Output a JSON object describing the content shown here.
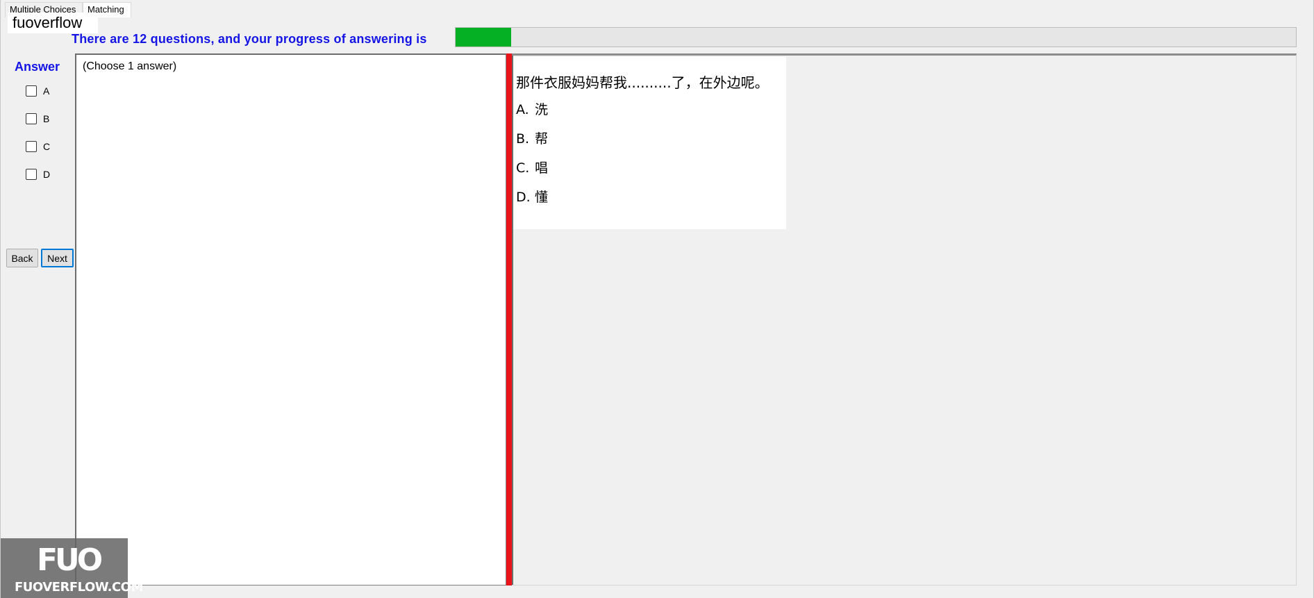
{
  "tabs": [
    {
      "label": "Multiple Choices"
    },
    {
      "label": "Matching"
    }
  ],
  "watermark_label": "fuoverflow",
  "progress": {
    "text": "There are 12 questions, and your progress of answering is",
    "fraction": 0.066
  },
  "answer_panel": {
    "title": "Answer",
    "options": [
      "A",
      "B",
      "C",
      "D"
    ],
    "back_label": "Back",
    "next_label": "Next"
  },
  "question_area": {
    "hint": "(Choose 1 answer)"
  },
  "question": {
    "text": "那件衣服妈妈帮我..........了，在外边呢。",
    "choices": [
      {
        "letter": "A.",
        "text": "洗"
      },
      {
        "letter": "B.",
        "text": "帮"
      },
      {
        "letter": "C.",
        "text": "唱"
      },
      {
        "letter": "D.",
        "text": "懂"
      }
    ]
  },
  "logo": {
    "mark": "FUO",
    "text": "FUOVERFLOW.COM"
  },
  "colors": {
    "accent_blue": "#1414e6",
    "progress_green": "#06b025",
    "splitter_red": "#e8141a"
  }
}
